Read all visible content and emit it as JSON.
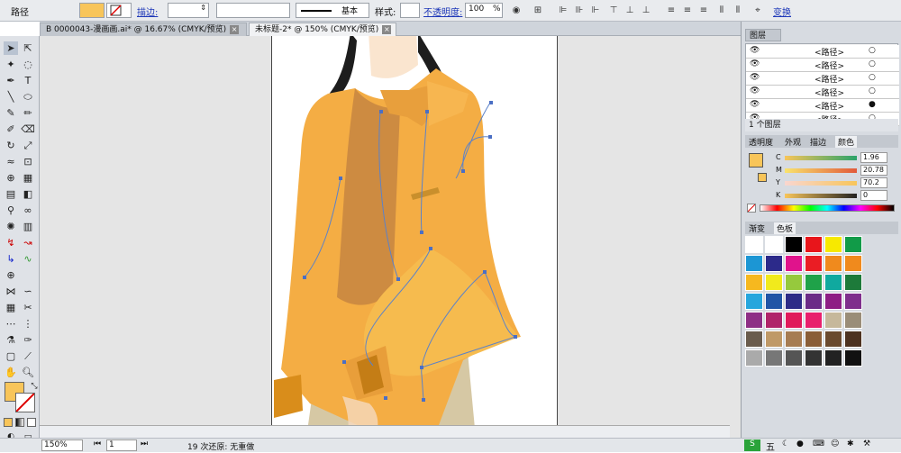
{
  "control_bar": {
    "object_type": "路径",
    "stroke_label": "描边:",
    "stroke_style": "基本",
    "style_label": "样式:",
    "opacity_label": "不透明度:",
    "opacity_value": "100",
    "opacity_unit": "%",
    "transform_label": "变换"
  },
  "tabs": [
    {
      "label": "B 0000043-漫画画.ai* @ 16.67% (CMYK/预览)",
      "active": false
    },
    {
      "label": "未标题-2* @ 150% (CMYK/预览)",
      "active": true
    }
  ],
  "layers_panel": {
    "title": "图层",
    "items": [
      "<路径>",
      "<路径>",
      "<路径>",
      "<路径>",
      "<路径>",
      "<路径>"
    ],
    "count_label": "1 个图层"
  },
  "color_panel": {
    "tabs": [
      "透明度",
      "外观",
      "描边",
      "颜色"
    ],
    "active_tab": "颜色",
    "channels": [
      {
        "name": "C",
        "value": "1.96"
      },
      {
        "name": "M",
        "value": "20.78"
      },
      {
        "name": "Y",
        "value": "70.2"
      },
      {
        "name": "K",
        "value": "0"
      }
    ],
    "fill_color": "#f8c55a"
  },
  "swatches_panel": {
    "tabs": [
      "渐变",
      "色板"
    ],
    "active_tab": "色板",
    "colors": [
      [
        "#ffffff",
        "#ffffff",
        "#000000",
        "#e8151b",
        "#f7e900",
        "#119b48"
      ],
      [
        "#1c96d4",
        "#2c2a8a",
        "#e0138c",
        "#ea1d24",
        "#f08a1d",
        "#f08a1d"
      ],
      [
        "#f6b81f",
        "#f1ea1c",
        "#96c93d",
        "#1fa249",
        "#10a99f",
        "#1d7a3a"
      ],
      [
        "#26a6dd",
        "#2155a6",
        "#2d2b87",
        "#6b2b87",
        "#8e1d84",
        "#7f2e8c"
      ],
      [
        "#8e2f86",
        "#b0246a",
        "#e01a5b",
        "#e8206d",
        "#c6b89b",
        "#9a8d78"
      ],
      [
        "#6a5c4d",
        "#bf9967",
        "#a67c52",
        "#8a5e37",
        "#6a4a2e",
        "#4d3220"
      ],
      [
        "#aaaaaa",
        "#777777",
        "#555555",
        "#333333",
        "#222222",
        "#111111"
      ]
    ]
  },
  "status_bar": {
    "zoom": "150%",
    "page": "1",
    "undo_text": "19 次还原: 无重做"
  },
  "taskbar": {
    "ime_label": "五"
  }
}
